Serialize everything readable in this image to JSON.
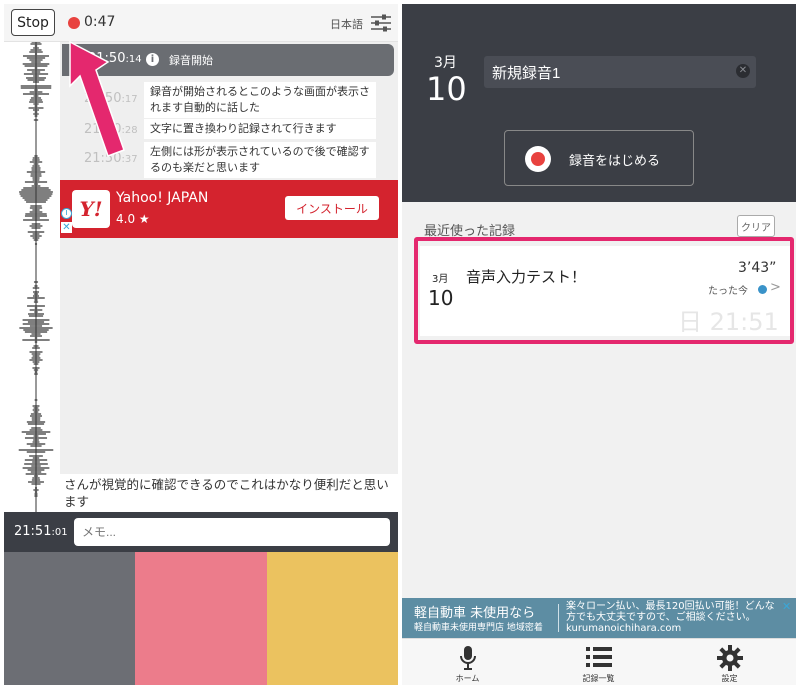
{
  "left": {
    "stop_label": "Stop",
    "rec_time": "0:47",
    "language": "日本語",
    "start_banner": {
      "time_main": "21:50",
      "time_sub": ":14",
      "text": "録音開始"
    },
    "logs": [
      {
        "time_main": "21:50",
        "time_sub": ":17",
        "text": "録音が開始されるとこのような画面が表示されます自動的に話した"
      },
      {
        "time_main": "21:50",
        "time_sub": ":28",
        "text": "文字に置き換わり記録されて行きます"
      },
      {
        "time_main": "21:50",
        "time_sub": ":37",
        "text": "左側には形が表示されているので後で確認するのも楽だと思います"
      }
    ],
    "ad": {
      "name": "Yahoo! JAPAN",
      "rating": "4.0 ★",
      "install_label": "インストール",
      "logo": "Y!"
    },
    "bottom_text": "さんが視覚的に確認できるのでこれはかなり便利だと思います",
    "memo_time_main": "21:51",
    "memo_time_sub": ":01",
    "memo_placeholder": "メモ...",
    "colors": [
      "#6c6e74",
      "#ec7c8b",
      "#ebc25f"
    ]
  },
  "right": {
    "date_month": "3月",
    "date_day": "10",
    "title_value": "新規録音1",
    "start_button_label": "録音をはじめる",
    "recent_label": "最近使った記録",
    "clear_label": "クリア",
    "record": {
      "month": "3月",
      "day": "10",
      "title": "音声入力テスト！",
      "duration": "3’43”",
      "ago": "たった今",
      "datetime": "日 21:51"
    },
    "ad": {
      "title": "軽自動車 未使用なら",
      "subtitle": "軽自動車未使用専門店 地域密着",
      "desc": "楽々ローン払い、最長120回払い可能！どんな方でも大丈夫ですので、ご相談ください。 kurumanoichihara.com"
    },
    "tabs": [
      {
        "label": "ホーム",
        "icon": "microphone-icon"
      },
      {
        "label": "記録一覧",
        "icon": "list-icon"
      },
      {
        "label": "設定",
        "icon": "gear-icon"
      }
    ]
  },
  "accent_colors": {
    "highlight": "#e4286e",
    "record_red": "#e8423f",
    "dark": "#3b3e45"
  }
}
